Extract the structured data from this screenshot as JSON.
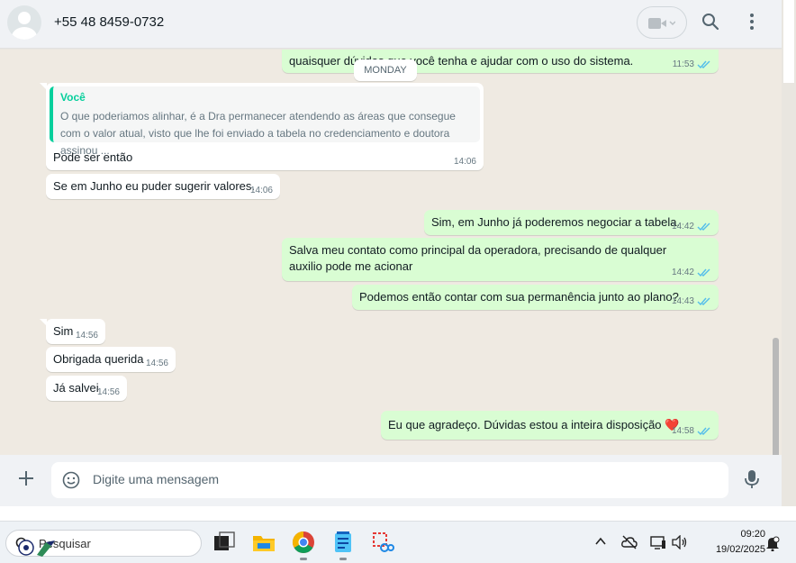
{
  "header": {
    "contact_name": "+55 48 8459-0732",
    "icons": {
      "avatar": "default-avatar-icon",
      "video": "video-camera-icon",
      "search": "search-icon",
      "menu": "vertical-dots-icon"
    }
  },
  "chat": {
    "day_divider": "MONDAY",
    "messages": [
      {
        "dir": "out",
        "text": "quaisquer dúvidas que você tenha e ajudar com o uso do sistema.",
        "time": "11:53",
        "status": "read"
      },
      {
        "dir": "in",
        "quote_author": "Você",
        "quote_text": "O que poderiamos alinhar, é a Dra permanecer atendendo as áreas que consegue com o valor atual, visto que lhe foi enviado a tabela no credenciamento e doutora assinou ...",
        "text": "Pode ser então",
        "time": "14:06"
      },
      {
        "dir": "in",
        "text": "Se em Junho eu puder sugerir valores.",
        "time": "14:06"
      },
      {
        "dir": "out",
        "text": "Sim, em Junho já poderemos negociar a tabela.",
        "time": "14:42",
        "status": "read"
      },
      {
        "dir": "out",
        "text": "Salva meu contato como principal da operadora, precisando de qualquer auxilio pode me acionar",
        "time": "14:42",
        "status": "read"
      },
      {
        "dir": "out",
        "text": "Podemos então contar com sua permanência junto ao plano?",
        "time": "14:43",
        "status": "read"
      },
      {
        "dir": "in",
        "text": "Sim",
        "time": "14:56"
      },
      {
        "dir": "in",
        "text": "Obrigada querida",
        "time": "14:56"
      },
      {
        "dir": "in",
        "text": "Já salvei",
        "time": "14:56"
      },
      {
        "dir": "out",
        "text": "Eu que agradeço. Dúvidas estou a inteira disposição",
        "emoji": "❤️",
        "time": "14:58",
        "status": "read"
      }
    ]
  },
  "composer": {
    "placeholder": "Digite uma mensagem",
    "icons": {
      "attach": "plus-icon",
      "sticker": "sticker-icon",
      "voice": "microphone-icon"
    }
  },
  "taskbar": {
    "search_label": "Pesquisar",
    "apps": [
      "task-view-icon",
      "file-explorer-icon",
      "chrome-icon",
      "notepad-icon",
      "snipping-tool-icon"
    ],
    "tray": [
      "chevron-up-icon",
      "cloud-off-icon",
      "network-icon",
      "speaker-icon",
      "notification-icon"
    ],
    "time": "09:20",
    "date": "19/02/2025"
  },
  "colors": {
    "chat_bg": "#efeae2",
    "incoming_bubble": "#ffffff",
    "outgoing_bubble": "#d9fdd3",
    "quote_accent": "#06cf9c",
    "read_check": "#53bdeb"
  }
}
